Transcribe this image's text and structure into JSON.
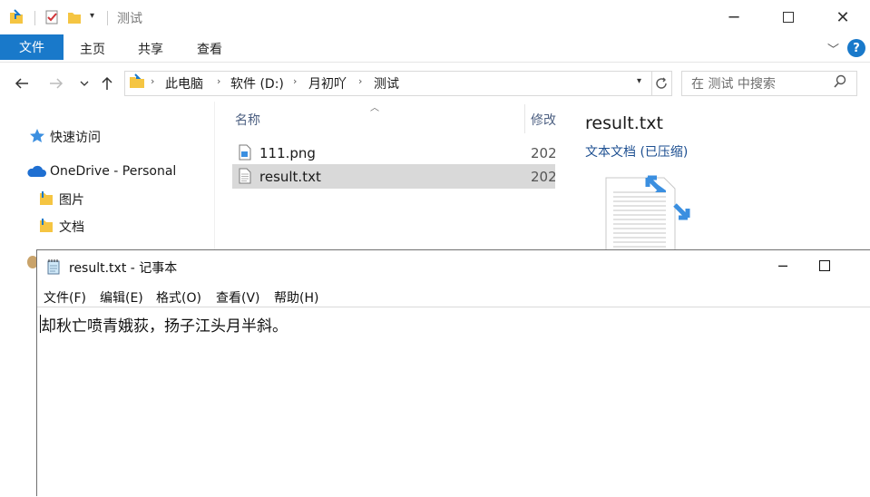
{
  "explorer": {
    "title": "测试",
    "ribbon": {
      "file_tab": "文件",
      "tabs": [
        "主页",
        "共享",
        "查看"
      ],
      "help": "?"
    },
    "address": {
      "crumbs": [
        "此电脑",
        "软件 (D:)",
        "月初吖",
        "测试"
      ]
    },
    "search": {
      "placeholder": "在 测试 中搜索"
    },
    "nav": {
      "quick_access": "快速访问",
      "onedrive": "OneDrive - Personal",
      "pictures": "图片",
      "documents": "文档"
    },
    "filelist": {
      "col_name": "名称",
      "col_modified": "修改",
      "rows": [
        {
          "name": "111.png",
          "date": "202"
        },
        {
          "name": "result.txt",
          "date": "202"
        }
      ]
    },
    "preview": {
      "title": "result.txt",
      "type": "文本文档 (已压缩)"
    }
  },
  "notepad": {
    "title": "result.txt - 记事本",
    "menus": [
      "文件(F)",
      "编辑(E)",
      "格式(O)",
      "查看(V)",
      "帮助(H)"
    ],
    "content": "却秋亡喷青娥荻，扬子江头月半斜。"
  },
  "colors": {
    "accent": "#1979ca",
    "selection": "#d9d9d9",
    "folder": "#f5c542"
  }
}
